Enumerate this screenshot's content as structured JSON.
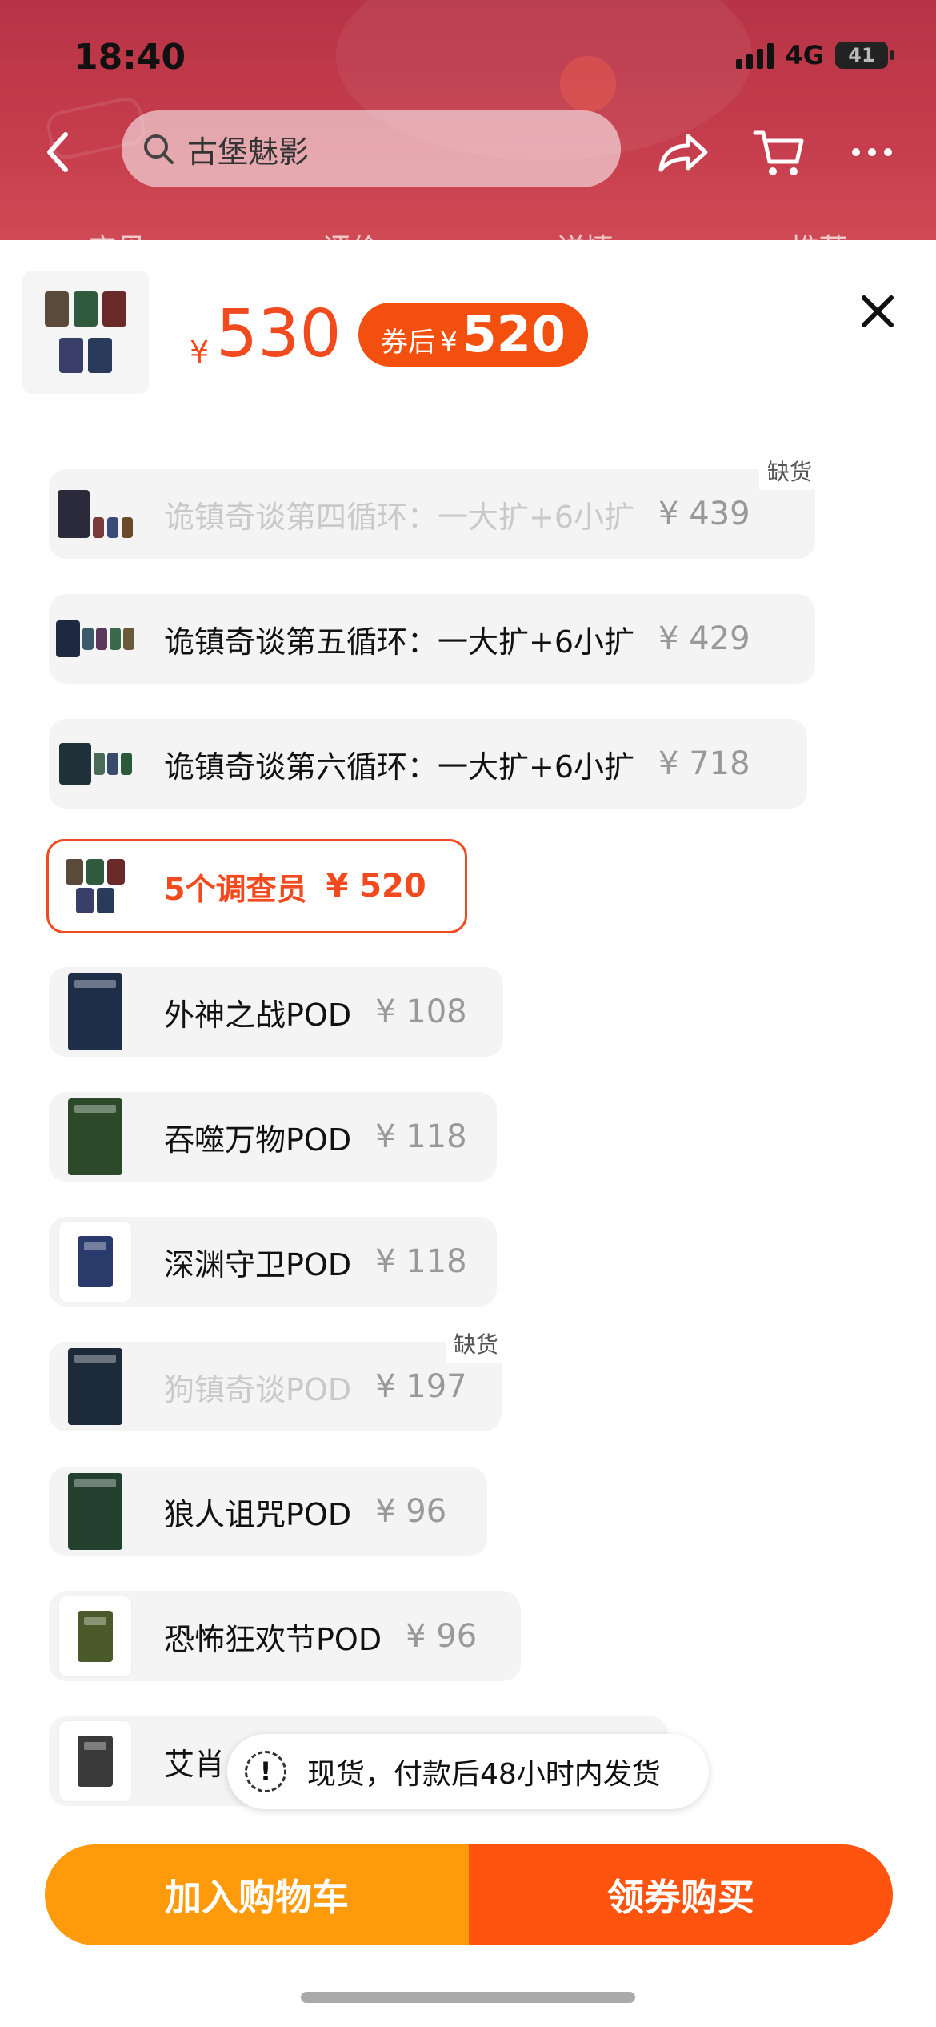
{
  "status": {
    "time": "18:40",
    "network": "4G",
    "battery": "41"
  },
  "nav": {
    "search_text": "古堡魅影",
    "tabs": [
      "宝贝",
      "评价",
      "详情",
      "推荐"
    ]
  },
  "selected": {
    "yen": "¥",
    "price": "530",
    "coupon_label": "券后",
    "coupon_yen": "¥",
    "coupon_price": "520"
  },
  "options": [
    {
      "name": "诡镇奇谈第四循环：一大扩+6小扩",
      "price": "¥ 439",
      "out_of_stock": true,
      "oos_label": "缺货"
    },
    {
      "name": "诡镇奇谈第五循环：一大扩+6小扩",
      "price": "¥ 429",
      "out_of_stock": false
    },
    {
      "name": "诡镇奇谈第六循环：一大扩+6小扩",
      "price": "¥ 718",
      "out_of_stock": false
    },
    {
      "name": "5个调查员",
      "price": "¥ 520",
      "out_of_stock": false,
      "selected": true
    },
    {
      "name": "外神之战POD",
      "price": "¥ 108",
      "out_of_stock": false
    },
    {
      "name": "吞噬万物POD",
      "price": "¥ 118",
      "out_of_stock": false
    },
    {
      "name": "深渊守卫POD",
      "price": "¥ 118",
      "out_of_stock": false
    },
    {
      "name": "狗镇奇谈POD",
      "price": "¥ 197",
      "out_of_stock": true,
      "oos_label": "缺货"
    },
    {
      "name": "狼人诅咒POD",
      "price": "¥ 96",
      "out_of_stock": false
    },
    {
      "name": "恐怖狂欢节POD",
      "price": "¥ 96",
      "out_of_stock": false
    },
    {
      "name": "艾肖",
      "price": "",
      "out_of_stock": false
    }
  ],
  "tip": {
    "icon": "!",
    "text": "现货，付款后48小时内发货"
  },
  "buttons": {
    "add_cart": "加入购物车",
    "buy": "领券购买"
  },
  "colors": {
    "accent": "#f04a1e",
    "cart_btn": "#ff9a0a",
    "buy_btn": "#ff5410"
  }
}
